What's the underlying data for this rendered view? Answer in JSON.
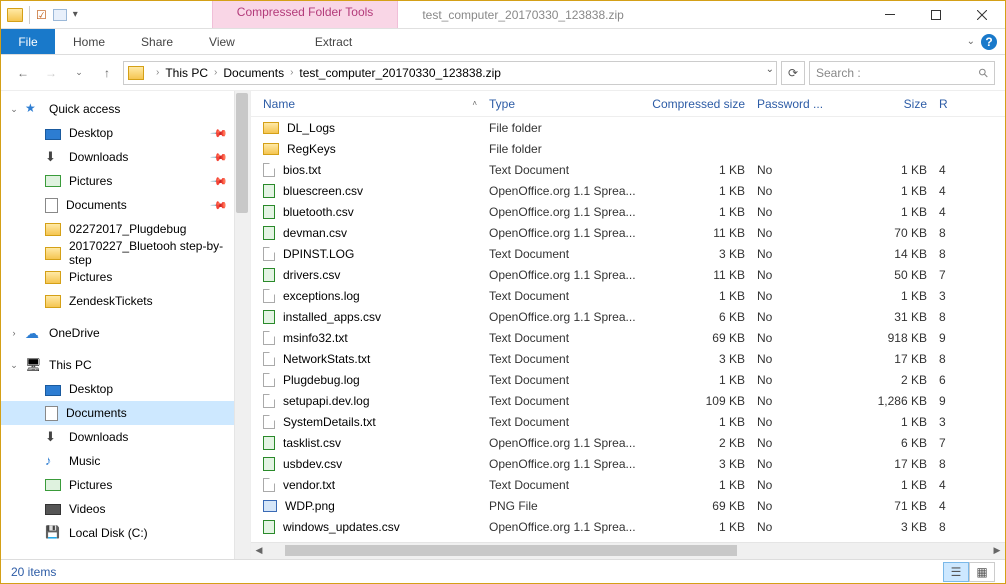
{
  "titlebar": {
    "context_tab": "Compressed Folder Tools",
    "title": "test_computer_20170330_123838.zip"
  },
  "ribbon": {
    "file": "File",
    "tabs": [
      "Home",
      "Share",
      "View"
    ],
    "extract": "Extract"
  },
  "breadcrumb": {
    "parts": [
      "This PC",
      "Documents",
      "test_computer_20170330_123838.zip"
    ]
  },
  "search": {
    "placeholder": "Search :"
  },
  "nav": {
    "quick_access": "Quick access",
    "qa_items": [
      {
        "label": "Desktop",
        "pinned": true,
        "ico": "desktop"
      },
      {
        "label": "Downloads",
        "pinned": true,
        "ico": "down"
      },
      {
        "label": "Pictures",
        "pinned": true,
        "ico": "pic"
      },
      {
        "label": "Documents",
        "pinned": true,
        "ico": "doc"
      },
      {
        "label": "02272017_Plugdebug",
        "pinned": false,
        "ico": "folder"
      },
      {
        "label": "20170227_Bluetooh step-by-step",
        "pinned": false,
        "ico": "folder"
      },
      {
        "label": "Pictures",
        "pinned": false,
        "ico": "folder"
      },
      {
        "label": "ZendeskTickets",
        "pinned": false,
        "ico": "folder"
      }
    ],
    "onedrive": "OneDrive",
    "thispc": "This PC",
    "pc_items": [
      {
        "label": "Desktop",
        "ico": "desktop"
      },
      {
        "label": "Documents",
        "ico": "doc",
        "selected": true
      },
      {
        "label": "Downloads",
        "ico": "down"
      },
      {
        "label": "Music",
        "ico": "music"
      },
      {
        "label": "Pictures",
        "ico": "pic"
      },
      {
        "label": "Videos",
        "ico": "video"
      },
      {
        "label": "Local Disk (C:)",
        "ico": "disk"
      }
    ]
  },
  "columns": {
    "name": "Name",
    "type": "Type",
    "csize": "Compressed size",
    "pwd": "Password ...",
    "size": "Size",
    "r": "R"
  },
  "files": [
    {
      "name": "DL_Logs",
      "type": "File folder",
      "csize": "",
      "pwd": "",
      "size": "",
      "r": "",
      "ico": "folder"
    },
    {
      "name": "RegKeys",
      "type": "File folder",
      "csize": "",
      "pwd": "",
      "size": "",
      "r": "",
      "ico": "folder"
    },
    {
      "name": "bios.txt",
      "type": "Text Document",
      "csize": "1 KB",
      "pwd": "No",
      "size": "1 KB",
      "r": "4",
      "ico": "txt"
    },
    {
      "name": "bluescreen.csv",
      "type": "OpenOffice.org 1.1 Sprea...",
      "csize": "1 KB",
      "pwd": "No",
      "size": "1 KB",
      "r": "4",
      "ico": "csv"
    },
    {
      "name": "bluetooth.csv",
      "type": "OpenOffice.org 1.1 Sprea...",
      "csize": "1 KB",
      "pwd": "No",
      "size": "1 KB",
      "r": "4",
      "ico": "csv"
    },
    {
      "name": "devman.csv",
      "type": "OpenOffice.org 1.1 Sprea...",
      "csize": "11 KB",
      "pwd": "No",
      "size": "70 KB",
      "r": "8",
      "ico": "csv"
    },
    {
      "name": "DPINST.LOG",
      "type": "Text Document",
      "csize": "3 KB",
      "pwd": "No",
      "size": "14 KB",
      "r": "8",
      "ico": "txt"
    },
    {
      "name": "drivers.csv",
      "type": "OpenOffice.org 1.1 Sprea...",
      "csize": "11 KB",
      "pwd": "No",
      "size": "50 KB",
      "r": "7",
      "ico": "csv"
    },
    {
      "name": "exceptions.log",
      "type": "Text Document",
      "csize": "1 KB",
      "pwd": "No",
      "size": "1 KB",
      "r": "3",
      "ico": "txt"
    },
    {
      "name": "installed_apps.csv",
      "type": "OpenOffice.org 1.1 Sprea...",
      "csize": "6 KB",
      "pwd": "No",
      "size": "31 KB",
      "r": "8",
      "ico": "csv"
    },
    {
      "name": "msinfo32.txt",
      "type": "Text Document",
      "csize": "69 KB",
      "pwd": "No",
      "size": "918 KB",
      "r": "9",
      "ico": "txt"
    },
    {
      "name": "NetworkStats.txt",
      "type": "Text Document",
      "csize": "3 KB",
      "pwd": "No",
      "size": "17 KB",
      "r": "8",
      "ico": "txt"
    },
    {
      "name": "Plugdebug.log",
      "type": "Text Document",
      "csize": "1 KB",
      "pwd": "No",
      "size": "2 KB",
      "r": "6",
      "ico": "txt"
    },
    {
      "name": "setupapi.dev.log",
      "type": "Text Document",
      "csize": "109 KB",
      "pwd": "No",
      "size": "1,286 KB",
      "r": "9",
      "ico": "txt"
    },
    {
      "name": "SystemDetails.txt",
      "type": "Text Document",
      "csize": "1 KB",
      "pwd": "No",
      "size": "1 KB",
      "r": "3",
      "ico": "txt"
    },
    {
      "name": "tasklist.csv",
      "type": "OpenOffice.org 1.1 Sprea...",
      "csize": "2 KB",
      "pwd": "No",
      "size": "6 KB",
      "r": "7",
      "ico": "csv"
    },
    {
      "name": "usbdev.csv",
      "type": "OpenOffice.org 1.1 Sprea...",
      "csize": "3 KB",
      "pwd": "No",
      "size": "17 KB",
      "r": "8",
      "ico": "csv"
    },
    {
      "name": "vendor.txt",
      "type": "Text Document",
      "csize": "1 KB",
      "pwd": "No",
      "size": "1 KB",
      "r": "4",
      "ico": "txt"
    },
    {
      "name": "WDP.png",
      "type": "PNG File",
      "csize": "69 KB",
      "pwd": "No",
      "size": "71 KB",
      "r": "4",
      "ico": "png"
    },
    {
      "name": "windows_updates.csv",
      "type": "OpenOffice.org 1.1 Sprea...",
      "csize": "1 KB",
      "pwd": "No",
      "size": "3 KB",
      "r": "8",
      "ico": "csv"
    }
  ],
  "status": {
    "count": "20 items"
  }
}
